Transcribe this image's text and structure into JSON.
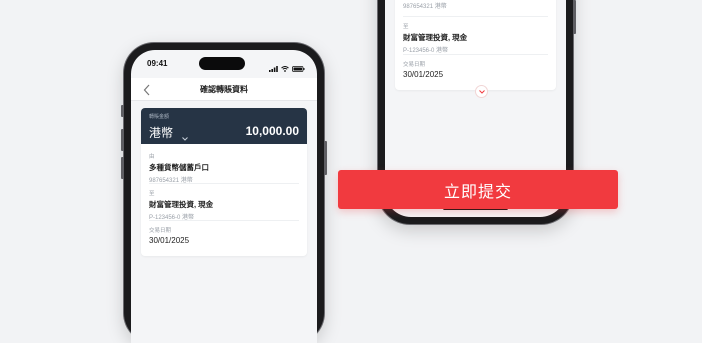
{
  "left_screen": {
    "status_time": "09:41",
    "nav_title": "確認轉賬資料",
    "amount": {
      "caption": "轉賬金額",
      "currency": "港幣",
      "value": "10,000.00"
    },
    "from": {
      "label": "由",
      "account_name": "多種貨幣儲蓄戶口",
      "account_detail": "987654321 港幣"
    },
    "to": {
      "label": "至",
      "account_name": "財富管理投資, 現金",
      "account_detail": "P-123456-0 港幣"
    },
    "date": {
      "label": "交易日期",
      "value": "30/01/2025"
    }
  },
  "right_screen": {
    "from_detail": "987654321 港幣",
    "to": {
      "label": "至",
      "account_name": "財富管理投資, 現金",
      "account_detail": "P-123456-0 港幣"
    },
    "date": {
      "label": "交易日期",
      "value": "30/01/2025"
    }
  },
  "submit_label": "立即提交",
  "colors": {
    "accent": "#f13a3f",
    "amount_band": "#263445",
    "background": "#f2f3f5"
  },
  "icons": [
    "signal-icon",
    "wifi-icon",
    "battery-icon",
    "back-arrow-icon",
    "chevron-down-icon",
    "expand-chevron-icon"
  ]
}
